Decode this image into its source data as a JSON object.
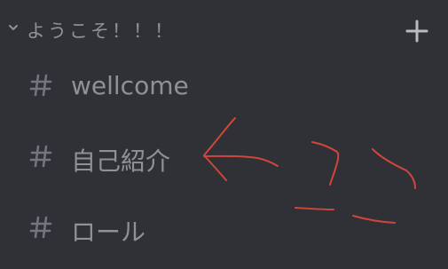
{
  "category": {
    "label": "ようこそ！！！",
    "collapse_icon": "chevron-down-icon",
    "add_icon": "plus-icon"
  },
  "channels": [
    {
      "label": "wellcome",
      "icon": "hash-icon"
    },
    {
      "label": "自己紹介",
      "icon": "hash-icon"
    },
    {
      "label": "ロール",
      "icon": "hash-icon"
    }
  ],
  "colors": {
    "background": "#2f3136",
    "text_muted": "#8e9297",
    "annotation": "#d0463b"
  }
}
